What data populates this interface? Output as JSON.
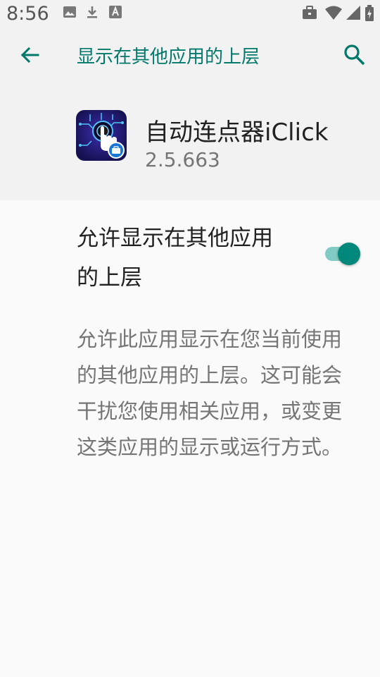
{
  "status_bar": {
    "time": "8:56"
  },
  "toolbar": {
    "title": "显示在其他应用的上层"
  },
  "app": {
    "name": "自动连点器iClick",
    "version": "2.5.663"
  },
  "setting": {
    "title": "允许显示在其他应用的上层",
    "toggle_state": "on"
  },
  "description": "允许此应用显示在您当前使用的其他应用的上层。这可能会干扰您使用相关应用，或变更这类应用的显示或运行方式。",
  "colors": {
    "accent": "#00796b",
    "toggle_thumb": "#00897b",
    "toggle_track": "#80cbc4",
    "header_bg": "#f2f2f2",
    "page_bg": "#fafafa"
  }
}
